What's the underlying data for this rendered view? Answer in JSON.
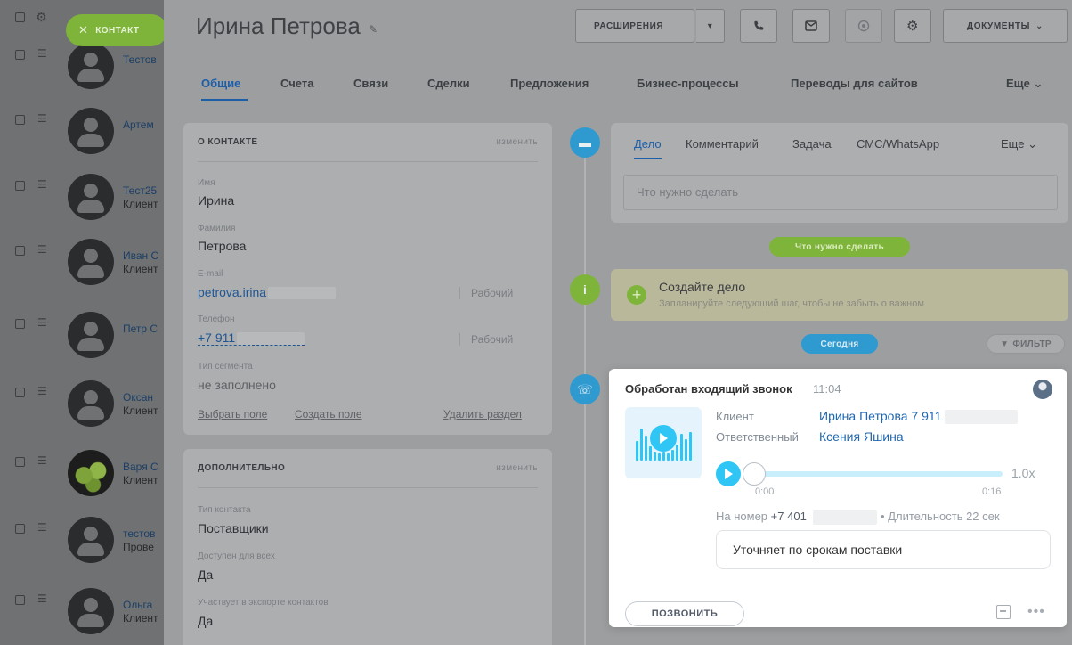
{
  "contacts_list": {
    "add_button_label": "КОНТАКТ",
    "rows": [
      {
        "name": "Тестов",
        "sub": ""
      },
      {
        "name": "Артем",
        "sub": ""
      },
      {
        "name": "Тест25",
        "sub": "Клиент"
      },
      {
        "name": "Иван С",
        "sub": "Клиент"
      },
      {
        "name": "Петр С",
        "sub": ""
      },
      {
        "name": "Оксан",
        "sub": "Клиент"
      },
      {
        "name": "Варя С",
        "sub": "Клиент"
      },
      {
        "name": "тестов",
        "sub": "Прове"
      },
      {
        "name": "Ольга",
        "sub": "Клиент"
      }
    ]
  },
  "contact": {
    "title": "Ирина Петрова",
    "toolbar": {
      "extensions_label": "РАСШИРЕНИЯ",
      "documents_label": "ДОКУМЕНТЫ"
    }
  },
  "tabs": [
    "Общие",
    "Счета",
    "Связи",
    "Сделки",
    "Предложения",
    "Бизнес-процессы",
    "Переводы для сайтов",
    "Еще"
  ],
  "about": {
    "header": "О КОНТАКТЕ",
    "edit_label": "изменить",
    "first_name_label": "Имя",
    "first_name": "Ирина",
    "last_name_label": "Фамилия",
    "last_name": "Петрова",
    "email_label": "E-mail",
    "email": "petrova.irina",
    "email_type": "Рабочий",
    "phone_label": "Телефон",
    "phone": "+7 911",
    "phone_type": "Рабочий",
    "segment_label": "Тип сегмента",
    "segment_value": "не заполнено",
    "select_field": "Выбрать поле",
    "create_field": "Создать поле",
    "delete_section": "Удалить раздел"
  },
  "extra": {
    "header": "ДОПОЛНИТЕЛЬНО",
    "edit_label": "изменить",
    "contact_type_label": "Тип контакта",
    "contact_type": "Поставщики",
    "available_label": "Доступен для всех",
    "available": "Да",
    "export_label": "Участвует в экспорте контактов",
    "export": "Да"
  },
  "timeline": {
    "tabs": [
      "Дело",
      "Комментарий",
      "Задача",
      "СМС/WhatsApp",
      "Еще"
    ],
    "input_placeholder": "Что нужно сделать",
    "todo_pill": "Что нужно сделать",
    "create_title": "Создайте дело",
    "create_hint": "Запланируйте следующий шаг, чтобы не забыть о важном",
    "today_pill": "Сегодня",
    "filter_label": "ФИЛЬТР"
  },
  "call": {
    "title": "Обработан входящий звонок",
    "time": "11:04",
    "client_label": "Клиент",
    "client_value": "Ирина Петрова 7 911",
    "responsible_label": "Ответственный",
    "responsible_value": "Ксения Яшина",
    "player_speed": "1.0x",
    "player_start": "0:00",
    "player_end": "0:16",
    "player_progress": 0,
    "meta_prefix": "На номер",
    "meta_number": "+7 401",
    "meta_duration": "• Длительность 22 сек",
    "comment": "Уточняет по срокам поставки",
    "call_button": "ПОЗВОНИТЬ"
  },
  "colors": {
    "accent": "#2fc6f6",
    "link": "#2067b0",
    "green": "#7fb43a"
  }
}
